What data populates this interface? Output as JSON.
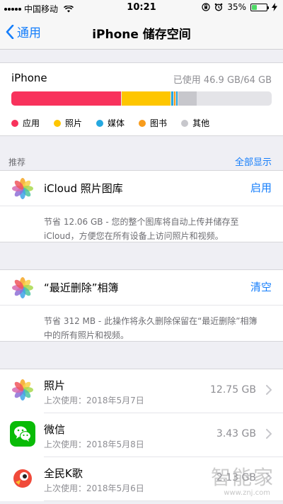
{
  "status": {
    "carrier": "中国移动",
    "time": "10:21",
    "battery_percent": "35%",
    "battery_level": 0.35
  },
  "nav": {
    "back_label": "通用",
    "title": "iPhone 储存空间"
  },
  "storage": {
    "device_name": "iPhone",
    "used_text": "已使用 46.9 GB/64 GB",
    "segments": [
      {
        "name": "应用",
        "color": "#f8325c",
        "fraction": 0.42
      },
      {
        "name": "照片",
        "color": "#fec600",
        "fraction": 0.19
      },
      {
        "name": "媒体",
        "color": "#25a8e0",
        "fraction": 0.006
      },
      {
        "name": "图书",
        "color": "#f89c1c",
        "fraction": 0.006
      },
      {
        "name": "媒体",
        "color": "#25a8e0",
        "fraction": 0.006
      },
      {
        "name": "其他",
        "color": "#c7c7cc",
        "fraction": 0.07
      }
    ],
    "legend": [
      {
        "label": "应用",
        "color": "#f8325c"
      },
      {
        "label": "照片",
        "color": "#fec600"
      },
      {
        "label": "媒体",
        "color": "#25a8e0"
      },
      {
        "label": "图书",
        "color": "#f89c1c"
      },
      {
        "label": "其他",
        "color": "#c7c7cc"
      }
    ]
  },
  "recommendations": {
    "header": "推荐",
    "show_all": "全部显示",
    "items": [
      {
        "icon": "photos-icon",
        "title": "iCloud 照片图库",
        "action": "启用",
        "desc_line1": "节省 12.06 GB - 您的整个图库将自动上传并储存至",
        "desc_line2": "iCloud，方便您在所有设备上访问照片和视频。"
      },
      {
        "icon": "photos-icon",
        "title": "“最近删除”相簿",
        "action": "清空",
        "desc_line1": "节省 312 MB - 此操作将永久删除保留在“最近删除”相簿",
        "desc_line2": "中的所有照片和视频。"
      }
    ]
  },
  "apps": [
    {
      "name": "照片",
      "last_used": "上次使用：2018年5月7日",
      "size": "12.75 GB",
      "icon": "photos-icon"
    },
    {
      "name": "微信",
      "last_used": "上次使用：2018年5月8日",
      "size": "3.43 GB",
      "icon": "wechat-icon"
    },
    {
      "name": "全民K歌",
      "last_used": "上次使用：2018年5月6日",
      "size": "2.13 GB",
      "icon": "kge-icon"
    }
  ],
  "watermark": {
    "text": "智能家",
    "url": "www.znj.com"
  }
}
